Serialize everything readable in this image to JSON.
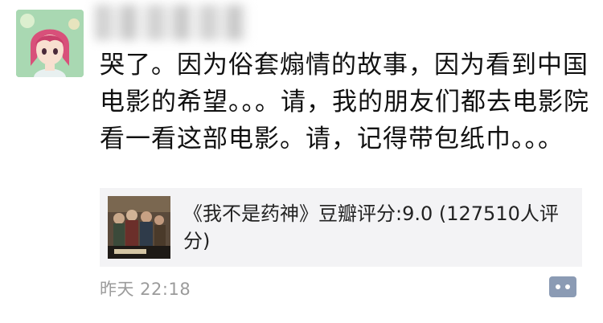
{
  "post": {
    "text": "哭了。因为俗套煽情的故事，因为看到中国电影的希望。。。请，我的朋友们都去电影院看一看这部电影。请，记得带包纸巾。。。",
    "timestamp": "昨天 22:18"
  },
  "share": {
    "title": "《我不是药神》豆瓣评分:9.0 (127510人评分)",
    "thumbnail_icon": "movie-poster-thumbnail"
  },
  "actions": {
    "comment_icon": "comment-bubble-icon",
    "accent": "#8b9bb4"
  }
}
